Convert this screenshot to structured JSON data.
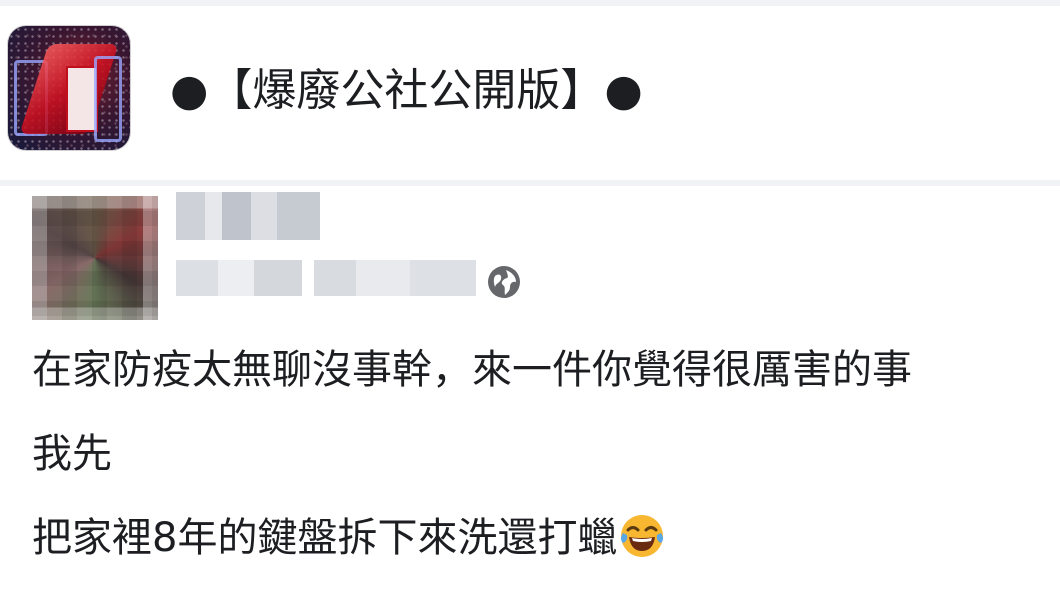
{
  "group": {
    "title": "●【爆廢公社公開版】●",
    "icon": "group-avatar-icon"
  },
  "post": {
    "author_avatar": "blurred-avatar",
    "privacy_icon": "globe-icon",
    "lines": [
      "在家防疫太無聊沒事幹，來一件你覺得很厲害的事",
      "我先",
      "把家裡8年的鍵盤拆下來洗還打蠟"
    ],
    "emoji": "tears-of-joy-emoji-icon"
  },
  "colors": {
    "text": "#1c1e21",
    "separator": "#f0f2f5",
    "globe": "#65676b"
  }
}
